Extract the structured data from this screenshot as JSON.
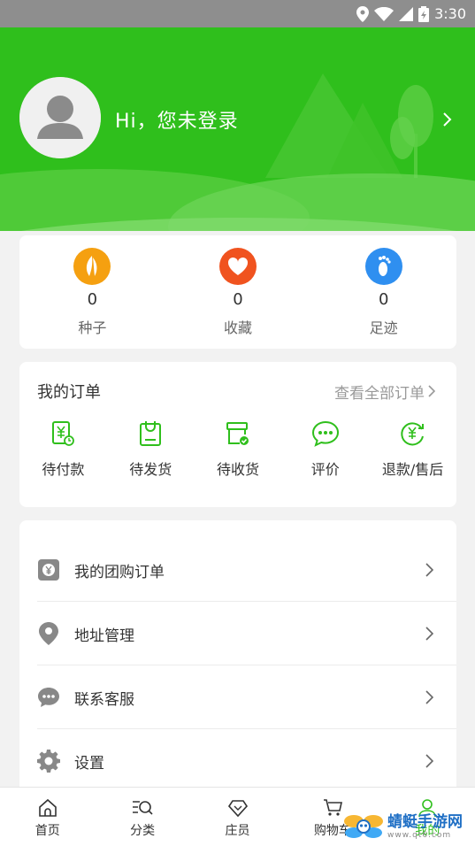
{
  "status_bar": {
    "time": "3:30",
    "icons": [
      "location-icon",
      "wifi-icon",
      "signal-icon",
      "battery-icon"
    ]
  },
  "header": {
    "greeting": "Hi，您未登录",
    "avatar_icon": "user-avatar-icon",
    "chevron_icon": "chevron-right-icon",
    "accent_color": "#2fbf1c"
  },
  "stats": [
    {
      "icon": "seed-icon",
      "count": "0",
      "label": "种子",
      "color": "#f5a010"
    },
    {
      "icon": "heart-icon",
      "count": "0",
      "label": "收藏",
      "color": "#f0531f"
    },
    {
      "icon": "footprint-icon",
      "count": "0",
      "label": "足迹",
      "color": "#2f8ff0"
    }
  ],
  "orders": {
    "title": "我的订单",
    "view_all": "查看全部订单",
    "items": [
      {
        "icon": "pending-payment-icon",
        "label": "待付款"
      },
      {
        "icon": "pending-shipment-icon",
        "label": "待发货"
      },
      {
        "icon": "pending-receipt-icon",
        "label": "待收货"
      },
      {
        "icon": "review-icon",
        "label": "评价"
      },
      {
        "icon": "refund-icon",
        "label": "退款/售后"
      }
    ]
  },
  "menu": [
    {
      "icon": "group-order-icon",
      "label": "我的团购订单"
    },
    {
      "icon": "location-pin-icon",
      "label": "地址管理"
    },
    {
      "icon": "chat-icon",
      "label": "联系客服"
    },
    {
      "icon": "settings-gear-icon",
      "label": "设置"
    }
  ],
  "tabbar": [
    {
      "icon": "home-icon",
      "label": "首页",
      "active": false
    },
    {
      "icon": "category-search-icon",
      "label": "分类",
      "active": false
    },
    {
      "icon": "diamond-icon",
      "label": "庄员",
      "active": false
    },
    {
      "icon": "cart-icon",
      "label": "购物车",
      "active": false
    },
    {
      "icon": "profile-icon",
      "label": "我的",
      "active": true
    }
  ],
  "watermark": {
    "main": "蜻蜓手游网",
    "sub": "www.qt6.com"
  }
}
